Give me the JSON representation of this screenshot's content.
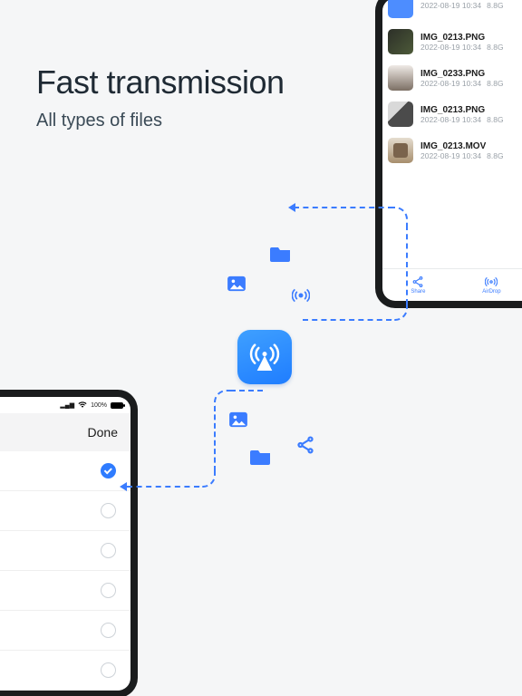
{
  "hero": {
    "title": "Fast transmission",
    "subtitle": "All types of files"
  },
  "right_device": {
    "files": [
      {
        "name": "",
        "date": "2022-08-19 10:34",
        "size": "8.8G",
        "thumb": "thumb-blue"
      },
      {
        "name": "IMG_0213.PNG",
        "date": "2022-08-19 10:34",
        "size": "8.8G",
        "thumb": "thumb-dark"
      },
      {
        "name": "IMG_0233.PNG",
        "date": "2022-08-19 10:34",
        "size": "8.8G",
        "thumb": "thumb-light"
      },
      {
        "name": "IMG_0213.PNG",
        "date": "2022-08-19 10:34",
        "size": "8.8G",
        "thumb": "thumb-bw"
      },
      {
        "name": "IMG_0213.MOV",
        "date": "2022-08-19 10:34",
        "size": "8.8G",
        "thumb": "thumb-beige"
      }
    ],
    "bottombar": {
      "share_label": "Share",
      "airdrop_label": "AirDrop"
    }
  },
  "left_device": {
    "status": {
      "signal": "",
      "wifi": "",
      "battery_pct": "100%"
    },
    "done_label": "Done",
    "rows": [
      {
        "checked": true
      },
      {
        "checked": false
      },
      {
        "checked": false
      },
      {
        "checked": false
      },
      {
        "checked": false
      },
      {
        "checked": false
      }
    ]
  },
  "colors": {
    "accent": "#3b7cff"
  }
}
